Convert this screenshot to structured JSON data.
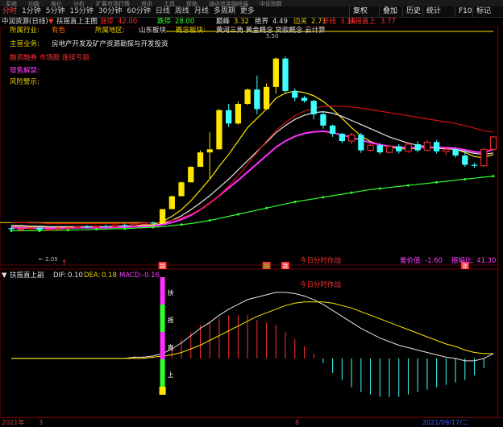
{
  "menubar": [
    "系统",
    "功能",
    "报价",
    "分析",
    "扩展市场行情",
    "资讯",
    "工具",
    "帮助",
    "通达信金融终端",
    "中证指数"
  ],
  "toolbar": {
    "timeframes": [
      "分时",
      "1分钟",
      "5分钟",
      "15分钟",
      "30分钟",
      "60分钟",
      "日线",
      "周线",
      "月线",
      "多周期",
      "更多"
    ],
    "active_index": 0,
    "right_buttons": [
      "复权",
      "叠加",
      "历史",
      "统计",
      "F10",
      "标记"
    ]
  },
  "title_row": {
    "stock": "中润资源(日线)",
    "indicator": "扶摇直上主图",
    "items": [
      {
        "label": "涨停",
        "value": "42.00"
      },
      {
        "label": "跌停",
        "value": "28.00"
      },
      {
        "label": "巅峰",
        "value": "3.32"
      },
      {
        "label": "绝界",
        "value": "4.49"
      },
      {
        "label": "边关",
        "value": "2.71"
      },
      {
        "label": "开线",
        "value": "3.16"
      },
      {
        "label": "扶摇直上",
        "value": "3.77"
      }
    ]
  },
  "info_panel": {
    "industry_label": "所属行业:",
    "industry": "有色",
    "region_label": "所属地区:",
    "region": "山东板块",
    "concept_label": "概念板块:",
    "concept": "黄河三角 黄金概念 贷款概念 云计算",
    "business_label": "主营业务:",
    "business": "房地产开发及矿产资源勘探与开发投资",
    "line3": "融资融券 市场股 连续亏损",
    "line4": "限售解禁:",
    "line5": "风险警示:"
  },
  "main_annotations": {
    "high_value": "5.50",
    "low_value": "← 2.05",
    "today_label": "今日分时作战",
    "diff_label": "差价值: -1.60",
    "range_label": "振幅比: 41.30",
    "signals": [
      "跳",
      "跳",
      "跳",
      "涨"
    ]
  },
  "sub_title": {
    "name": "扶摇直上副",
    "dif_label": "DIF:",
    "dif": "0.10",
    "dea_label": "DEA:",
    "dea": "0.18",
    "macd_label": "MACD:",
    "macd": "-0.16",
    "center_text": "今日分时作战",
    "vertical_chars": [
      "扶",
      "摇",
      "直",
      "上"
    ]
  },
  "bottom_axis": {
    "labels": [
      "2021年",
      "3",
      "8",
      "2021/09/17/二"
    ]
  },
  "colors": {
    "up": "#ff3030",
    "down": "#40ffff",
    "yellow": "#ffe600",
    "magenta": "#ff30ff",
    "green": "#30ff30",
    "white": "#e6e6e6",
    "darkred": "#d01010"
  },
  "chart_data": [
    {
      "type": "candlestick",
      "title": "扶摇直上主图",
      "y_range": [
        1.5,
        6.0
      ],
      "candles": [
        {
          "o": 2.09,
          "h": 2.12,
          "l": 2.03,
          "c": 2.07
        },
        {
          "o": 2.07,
          "h": 2.1,
          "l": 2.04,
          "c": 2.08
        },
        {
          "o": 2.08,
          "h": 2.12,
          "l": 2.06,
          "c": 2.1
        },
        {
          "o": 2.1,
          "h": 2.13,
          "l": 2.05,
          "c": 2.06
        },
        {
          "o": 2.06,
          "h": 2.09,
          "l": 2.04,
          "c": 2.07
        },
        {
          "o": 2.07,
          "h": 2.11,
          "l": 2.05,
          "c": 2.09
        },
        {
          "o": 2.09,
          "h": 2.12,
          "l": 2.07,
          "c": 2.1
        },
        {
          "o": 2.1,
          "h": 2.14,
          "l": 2.08,
          "c": 2.12
        },
        {
          "o": 2.12,
          "h": 2.15,
          "l": 2.09,
          "c": 2.11
        },
        {
          "o": 2.11,
          "h": 2.14,
          "l": 2.1,
          "c": 2.13
        },
        {
          "o": 2.13,
          "h": 2.16,
          "l": 2.1,
          "c": 2.12
        },
        {
          "o": 2.12,
          "h": 2.16,
          "l": 2.11,
          "c": 2.15
        },
        {
          "o": 2.15,
          "h": 2.18,
          "l": 2.12,
          "c": 2.14
        },
        {
          "o": 2.14,
          "h": 2.18,
          "l": 2.13,
          "c": 2.17
        },
        {
          "o": 2.17,
          "h": 2.21,
          "l": 2.15,
          "c": 2.2
        },
        {
          "o": 2.2,
          "h": 2.22,
          "l": 2.16,
          "c": 2.18
        },
        {
          "o": 2.18,
          "h": 2.46,
          "l": 2.18,
          "c": 2.46
        },
        {
          "o": 2.46,
          "h": 2.72,
          "l": 2.46,
          "c": 2.71
        },
        {
          "o": 2.71,
          "h": 2.99,
          "l": 2.71,
          "c": 2.98
        },
        {
          "o": 2.98,
          "h": 3.29,
          "l": 2.98,
          "c": 3.28
        },
        {
          "o": 3.28,
          "h": 3.6,
          "l": 3.28,
          "c": 3.56
        },
        {
          "o": 3.56,
          "h": 3.95,
          "l": 3.05,
          "c": 3.62
        },
        {
          "o": 3.62,
          "h": 4.4,
          "l": 3.62,
          "c": 4.38
        },
        {
          "o": 4.38,
          "h": 4.5,
          "l": 4.05,
          "c": 4.12
        },
        {
          "o": 4.12,
          "h": 4.55,
          "l": 4.1,
          "c": 4.5
        },
        {
          "o": 4.5,
          "h": 4.8,
          "l": 4.48,
          "c": 4.78
        },
        {
          "o": 4.78,
          "h": 5.05,
          "l": 4.3,
          "c": 4.4
        },
        {
          "o": 4.4,
          "h": 4.9,
          "l": 4.38,
          "c": 4.83
        },
        {
          "o": 4.83,
          "h": 5.4,
          "l": 4.7,
          "c": 5.38
        },
        {
          "o": 5.38,
          "h": 5.42,
          "l": 4.7,
          "c": 4.75
        },
        {
          "o": 4.75,
          "h": 4.8,
          "l": 4.55,
          "c": 4.62
        },
        {
          "o": 4.62,
          "h": 4.66,
          "l": 4.52,
          "c": 4.56
        },
        {
          "o": 4.56,
          "h": 4.58,
          "l": 4.2,
          "c": 4.3
        },
        {
          "o": 4.3,
          "h": 4.35,
          "l": 4.02,
          "c": 4.08
        },
        {
          "o": 4.08,
          "h": 4.1,
          "l": 3.86,
          "c": 3.92
        },
        {
          "o": 3.92,
          "h": 3.94,
          "l": 3.74,
          "c": 3.78
        },
        {
          "o": 3.78,
          "h": 3.95,
          "l": 3.72,
          "c": 3.9
        },
        {
          "o": 3.9,
          "h": 3.94,
          "l": 3.55,
          "c": 3.6
        },
        {
          "o": 3.6,
          "h": 3.72,
          "l": 3.58,
          "c": 3.7
        },
        {
          "o": 3.7,
          "h": 3.74,
          "l": 3.52,
          "c": 3.56
        },
        {
          "o": 3.56,
          "h": 3.7,
          "l": 3.54,
          "c": 3.68
        },
        {
          "o": 3.68,
          "h": 3.72,
          "l": 3.54,
          "c": 3.58
        },
        {
          "o": 3.58,
          "h": 3.76,
          "l": 3.55,
          "c": 3.72
        },
        {
          "o": 3.72,
          "h": 3.78,
          "l": 3.56,
          "c": 3.6
        },
        {
          "o": 3.6,
          "h": 3.8,
          "l": 3.58,
          "c": 3.76
        },
        {
          "o": 3.76,
          "h": 3.8,
          "l": 3.54,
          "c": 3.58
        },
        {
          "o": 3.58,
          "h": 3.66,
          "l": 3.5,
          "c": 3.62
        },
        {
          "o": 3.62,
          "h": 3.66,
          "l": 3.46,
          "c": 3.5
        },
        {
          "o": 3.5,
          "h": 3.6,
          "l": 3.28,
          "c": 3.32
        },
        {
          "o": 3.32,
          "h": 3.36,
          "l": 3.26,
          "c": 3.3
        },
        {
          "o": 3.3,
          "h": 3.64,
          "l": 3.28,
          "c": 3.62
        },
        {
          "o": 3.62,
          "h": 3.88,
          "l": 3.6,
          "c": 3.86
        }
      ],
      "ma_lines": [
        {
          "color": "#ffe600",
          "values": [
            2.13,
            2.13,
            2.12,
            2.12,
            2.11,
            2.11,
            2.11,
            2.11,
            2.12,
            2.12,
            2.12,
            2.13,
            2.13,
            2.14,
            2.15,
            2.16,
            2.22,
            2.32,
            2.45,
            2.62,
            2.83,
            3.04,
            3.29,
            3.52,
            3.78,
            4.04,
            4.22,
            4.4,
            4.61,
            4.71,
            4.75,
            4.72,
            4.66,
            4.55,
            4.4,
            4.22,
            4.04,
            3.88,
            3.77,
            3.71,
            3.67,
            3.63,
            3.63,
            3.64,
            3.66,
            3.64,
            3.63,
            3.62,
            3.56,
            3.48,
            3.46,
            3.52
          ]
        },
        {
          "color": "#e6e6e6",
          "values": [
            2.14,
            2.14,
            2.13,
            2.13,
            2.12,
            2.12,
            2.12,
            2.12,
            2.12,
            2.12,
            2.12,
            2.13,
            2.13,
            2.13,
            2.14,
            2.14,
            2.18,
            2.24,
            2.33,
            2.45,
            2.58,
            2.72,
            2.88,
            3.04,
            3.22,
            3.4,
            3.58,
            3.76,
            3.94,
            4.08,
            4.2,
            4.28,
            4.33,
            4.35,
            4.32,
            4.26,
            4.18,
            4.1,
            4.02,
            3.94,
            3.86,
            3.8,
            3.74,
            3.7,
            3.67,
            3.65,
            3.63,
            3.62,
            3.58,
            3.54,
            3.52,
            3.55
          ]
        },
        {
          "color": "#ff30ff",
          "values": [
            2.1,
            2.1,
            2.09,
            2.09,
            2.09,
            2.09,
            2.09,
            2.1,
            2.1,
            2.1,
            2.1,
            2.11,
            2.11,
            2.12,
            2.12,
            2.13,
            2.16,
            2.2,
            2.26,
            2.34,
            2.45,
            2.58,
            2.72,
            2.87,
            3.02,
            3.18,
            3.34,
            3.5,
            3.66,
            3.78,
            3.87,
            3.93,
            3.96,
            3.97,
            3.94,
            3.9,
            3.85,
            3.8,
            3.75,
            3.71,
            3.68,
            3.66,
            3.65,
            3.65,
            3.66,
            3.66,
            3.65,
            3.64,
            3.61,
            3.57,
            3.56,
            3.62
          ]
        },
        {
          "color": "#d01010",
          "values": [
            2.2,
            2.2,
            2.19,
            2.19,
            2.18,
            2.18,
            2.18,
            2.18,
            2.18,
            2.18,
            2.18,
            2.18,
            2.18,
            2.18,
            2.19,
            2.19,
            2.21,
            2.24,
            2.29,
            2.36,
            2.46,
            2.58,
            2.73,
            2.91,
            3.11,
            3.33,
            3.56,
            3.78,
            3.98,
            4.14,
            4.27,
            4.36,
            4.42,
            4.45,
            4.46,
            4.45,
            4.44,
            4.42,
            4.39,
            4.36,
            4.33,
            4.3,
            4.27,
            4.24,
            4.21,
            4.18,
            4.15,
            4.12,
            4.08,
            4.03,
            3.98,
            3.95
          ]
        },
        {
          "color": "#30ff30",
          "dotted": true,
          "values": [
            2.04,
            2.04,
            2.04,
            2.04,
            2.05,
            2.05,
            2.05,
            2.06,
            2.06,
            2.07,
            2.07,
            2.08,
            2.08,
            2.09,
            2.1,
            2.11,
            2.12,
            2.14,
            2.16,
            2.18,
            2.21,
            2.24,
            2.28,
            2.32,
            2.36,
            2.4,
            2.44,
            2.48,
            2.52,
            2.56,
            2.6,
            2.63,
            2.66,
            2.69,
            2.72,
            2.75,
            2.78,
            2.81,
            2.84,
            2.86,
            2.88,
            2.9,
            2.92,
            2.94,
            2.96,
            2.98,
            3.0,
            3.02,
            3.04,
            3.06,
            3.08,
            3.1
          ]
        }
      ]
    },
    {
      "type": "macd",
      "title": "扶摇直上副",
      "y_range": [
        -0.45,
        0.65
      ],
      "dif": [
        0.0,
        0.0,
        0.0,
        0.0,
        0.0,
        0.0,
        0.0,
        0.0,
        0.0,
        0.0,
        0.0,
        0.0,
        0.0,
        0.01,
        0.01,
        0.02,
        0.04,
        0.08,
        0.13,
        0.19,
        0.25,
        0.3,
        0.36,
        0.41,
        0.45,
        0.49,
        0.51,
        0.53,
        0.55,
        0.55,
        0.54,
        0.52,
        0.49,
        0.45,
        0.4,
        0.35,
        0.3,
        0.25,
        0.21,
        0.17,
        0.14,
        0.11,
        0.09,
        0.07,
        0.05,
        0.03,
        0.01,
        0.0,
        -0.02,
        -0.02,
        0.0,
        0.04
      ],
      "dea": [
        0.0,
        0.0,
        0.0,
        0.0,
        0.0,
        0.0,
        0.0,
        0.0,
        0.0,
        0.0,
        0.0,
        0.0,
        0.0,
        0.0,
        0.0,
        0.01,
        0.02,
        0.03,
        0.05,
        0.08,
        0.11,
        0.15,
        0.19,
        0.23,
        0.27,
        0.31,
        0.35,
        0.38,
        0.41,
        0.44,
        0.46,
        0.47,
        0.47,
        0.47,
        0.46,
        0.44,
        0.42,
        0.39,
        0.36,
        0.33,
        0.3,
        0.27,
        0.24,
        0.21,
        0.18,
        0.15,
        0.12,
        0.1,
        0.07,
        0.05,
        0.04,
        0.04
      ],
      "macd": [
        0.0,
        0.0,
        0.0,
        0.0,
        0.0,
        0.0,
        0.0,
        0.0,
        0.0,
        0.0,
        0.0,
        0.0,
        0.0,
        0.02,
        0.02,
        0.02,
        0.04,
        0.1,
        0.16,
        0.22,
        0.28,
        0.3,
        0.34,
        0.36,
        0.36,
        0.36,
        0.32,
        0.3,
        0.28,
        0.22,
        0.16,
        0.1,
        0.04,
        -0.04,
        -0.12,
        -0.18,
        -0.24,
        -0.28,
        -0.3,
        -0.32,
        -0.32,
        -0.32,
        -0.3,
        -0.28,
        -0.26,
        -0.24,
        -0.22,
        -0.2,
        -0.18,
        -0.14,
        -0.08,
        0.0
      ]
    }
  ]
}
